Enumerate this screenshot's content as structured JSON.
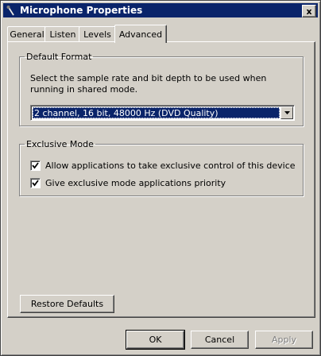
{
  "window": {
    "title": "Microphone Properties",
    "close_label": "x"
  },
  "tabs": [
    {
      "label": "General",
      "active": false
    },
    {
      "label": "Listen",
      "active": false
    },
    {
      "label": "Levels",
      "active": false
    },
    {
      "label": "Advanced",
      "active": true
    }
  ],
  "default_format": {
    "legend": "Default Format",
    "description": "Select the sample rate and bit depth to be used when running in shared mode.",
    "selected_value": "2 channel, 16 bit, 48000 Hz (DVD Quality)"
  },
  "exclusive_mode": {
    "legend": "Exclusive Mode",
    "options": [
      {
        "label": "Allow applications to take exclusive control of this device",
        "checked": true
      },
      {
        "label": "Give exclusive mode applications priority",
        "checked": true
      }
    ]
  },
  "restore_defaults_label": "Restore Defaults",
  "footer": {
    "ok_label": "OK",
    "cancel_label": "Cancel",
    "apply_label": "Apply"
  },
  "colors": {
    "titlebar": "#0a246a",
    "face": "#d4d0c8",
    "selection": "#0a246a"
  }
}
